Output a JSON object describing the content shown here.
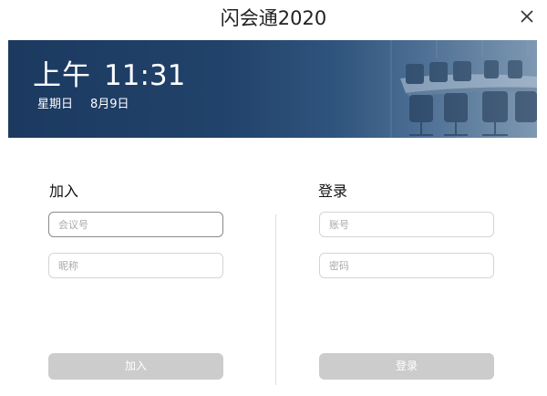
{
  "window": {
    "title": "闪会通2020",
    "close_icon": "close-icon"
  },
  "banner": {
    "ampm": "上午",
    "time": "11:31",
    "weekday": "星期日",
    "date": "8月9日",
    "background_color": "#1c3a60"
  },
  "join": {
    "heading": "加入",
    "meeting_id_placeholder": "会议号",
    "nickname_placeholder": "昵称",
    "button_label": "加入"
  },
  "login": {
    "heading": "登录",
    "account_placeholder": "账号",
    "password_placeholder": "密码",
    "button_label": "登录"
  },
  "colors": {
    "disabled_button": "#cccccc",
    "focused_border": "#8a8a8a"
  }
}
